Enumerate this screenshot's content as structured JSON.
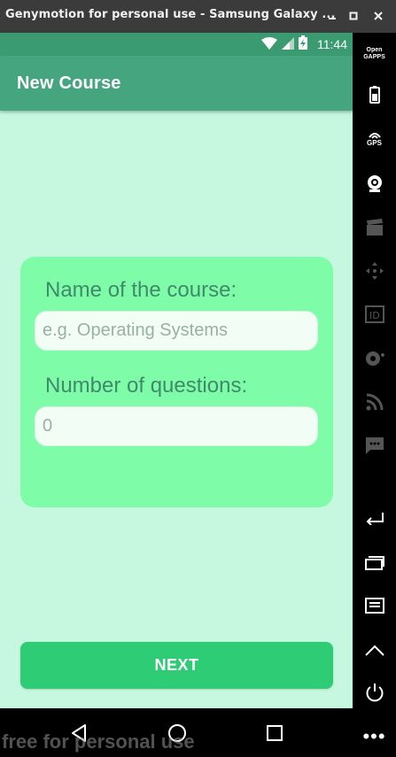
{
  "window": {
    "title": "Genymotion for personal use - Samsung Galaxy ...",
    "minimize_icon": "minimize-icon",
    "maximize_icon": "maximize-icon",
    "close_icon": "close-icon"
  },
  "statusbar": {
    "time": "11:44",
    "icons": [
      "wifi-icon",
      "signal-icon",
      "battery-charging-icon"
    ]
  },
  "appbar": {
    "title": "New Course"
  },
  "form": {
    "name_label": "Name of the course:",
    "name_placeholder": "e.g. Operating Systems",
    "name_value": "",
    "questions_label": "Number of questions:",
    "questions_placeholder": "0",
    "questions_value": ""
  },
  "actions": {
    "next_label": "NEXT"
  },
  "navbar": {
    "icons": [
      "back-icon",
      "home-icon",
      "recents-icon"
    ]
  },
  "watermark": "free for personal use",
  "sidebar": {
    "opengapps_line1": "Open",
    "opengapps_line2": "GAPPS",
    "gps_label": "GPS",
    "more_label": "•••",
    "tools": [
      "opengapps-icon",
      "battery-icon",
      "gps-icon",
      "webcam-icon",
      "capture-icon",
      "dpad-icon",
      "id-icon",
      "disk-icon",
      "cast-icon",
      "sms-icon",
      "back-icon",
      "recents-icon",
      "menu-icon",
      "home-icon",
      "power-icon",
      "more-icon"
    ]
  },
  "colors": {
    "titlebar": "#3b3b3b",
    "statusbar": "#3a9b71",
    "appbar": "#44a57e",
    "background": "#c5f8de",
    "card": "#7ffca8",
    "button": "#2ecc74"
  }
}
